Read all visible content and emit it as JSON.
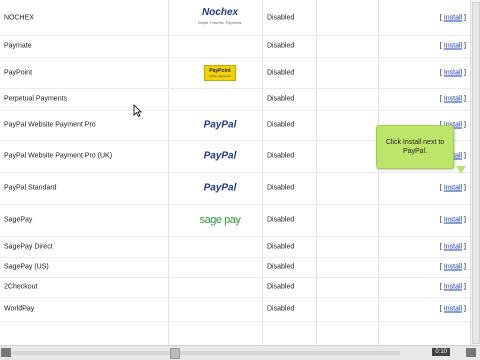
{
  "rows": [
    {
      "name": "NOCHEX",
      "logo": "nochex",
      "status": "Disabled",
      "action": "Install"
    },
    {
      "name": "Paymate",
      "logo": "",
      "status": "Disabled",
      "action": "Install"
    },
    {
      "name": "PayPoint",
      "logo": "paypoint",
      "status": "Disabled",
      "action": "Install"
    },
    {
      "name": "Perpetual Payments",
      "logo": "",
      "status": "Disabled",
      "action": "Install"
    },
    {
      "name": "PayPal Website Payment Pro",
      "logo": "paypal",
      "status": "Disabled",
      "action": "Install"
    },
    {
      "name": "PayPal Website Payment Pro (UK)",
      "logo": "paypal",
      "status": "Disabled",
      "action": "Install"
    },
    {
      "name": "PayPal Standard",
      "logo": "paypal",
      "status": "Disabled",
      "action": "Install"
    },
    {
      "name": "SagePay",
      "logo": "sagepay",
      "status": "Disabled",
      "action": "Install"
    },
    {
      "name": "SagePay Direct",
      "logo": "",
      "status": "Disabled",
      "action": "Install"
    },
    {
      "name": "SagePay (US)",
      "logo": "",
      "status": "Disabled",
      "action": "Install"
    },
    {
      "name": "2Checkout",
      "logo": "",
      "status": "Disabled",
      "action": "Install"
    },
    {
      "name": "WorldPay",
      "logo": "",
      "status": "Disabled",
      "action": "Install"
    }
  ],
  "logos": {
    "nochex": {
      "text": "Nochex",
      "sub": "Simple. Powerful. Payments."
    },
    "paypoint": {
      "text": "PayPoint",
      "sub": "online payments"
    },
    "paypal": {
      "text": "PayPal"
    },
    "sagepay": {
      "text": "sage pay"
    }
  },
  "tooltip": {
    "text": "Click Install next to PayPal."
  },
  "player": {
    "time": "0:10"
  },
  "colors": {
    "link": "#1a3fb5",
    "tooltip": "#bde56a"
  }
}
